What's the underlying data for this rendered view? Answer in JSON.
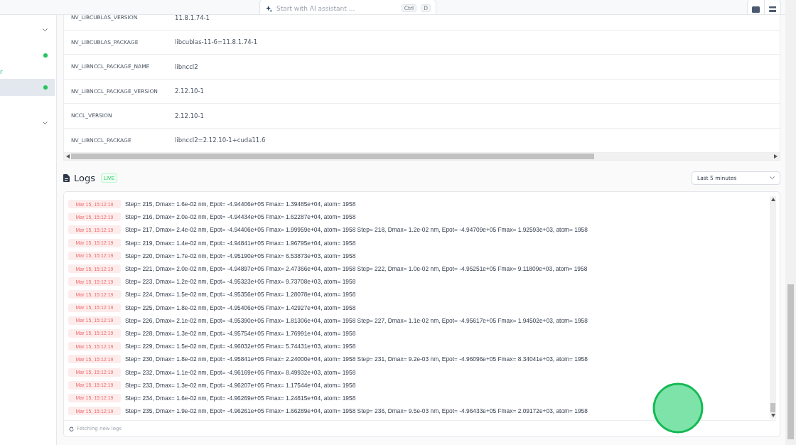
{
  "header": {
    "search": {
      "placeholder": "Start with AI assistant ...",
      "keys": [
        "Ctrl",
        "D"
      ]
    }
  },
  "sidebar": {
    "items": [
      {
        "kind": "group",
        "expanded": false
      },
      {
        "kind": "status",
        "color": "#22c55e",
        "selected": false
      },
      {
        "kind": "text",
        "label": "r"
      },
      {
        "kind": "status",
        "color": "#22c55e",
        "selected": true
      },
      {
        "kind": "group",
        "expanded": false
      }
    ]
  },
  "env_table": {
    "rows": [
      {
        "name": "NV_LIBCUBLAS_VERSION",
        "value": "11.8.1.74-1"
      },
      {
        "name": "NV_LIBCUBLAS_PACKAGE",
        "value": "libcublas-11-6=11.8.1.74-1"
      },
      {
        "name": "NV_LIBNCCL_PACKAGE_NAME",
        "value": "libnccl2"
      },
      {
        "name": "NV_LIBNCCL_PACKAGE_VERSION",
        "value": "2.12.10-1"
      },
      {
        "name": "NCCL_VERSION",
        "value": "2.12.10-1"
      },
      {
        "name": "NV_LIBNCCL_PACKAGE",
        "value": "libnccl2=2.12.10-1+cuda11.6"
      }
    ]
  },
  "logs": {
    "title": "Logs",
    "badge": "LIVE",
    "range": "Last 5 minutes",
    "entries": [
      {
        "time": "Mar 15, 15:12:19",
        "message": "Step= 215, Dmax= 1.6e-02 nm, Epot= -4.94406e+05 Fmax= 1.39485e+04, atom= 1958"
      },
      {
        "time": "Mar 15, 15:12:19",
        "message": "Step= 216, Dmax= 2.0e-02 nm, Epot= -4.94434e+05 Fmax= 1.62287e+04, atom= 1958"
      },
      {
        "time": "Mar 15, 15:12:19",
        "message": "Step= 217, Dmax= 2.4e-02 nm, Epot= -4.94406e+05 Fmax= 1.99959e+04, atom= 1958 Step= 218, Dmax= 1.2e-02 nm, Epot= -4.94709e+05 Fmax= 1.92593e+03, atom= 1958"
      },
      {
        "time": "Mar 15, 15:12:19",
        "message": "Step= 219, Dmax= 1.4e-02 nm, Epot= -4.94841e+05 Fmax= 1.96795e+04, atom= 1958"
      },
      {
        "time": "Mar 15, 15:12:19",
        "message": "Step= 220, Dmax= 1.7e-02 nm, Epot= -4.95190e+05 Fmax= 6.53873e+03, atom= 1958"
      },
      {
        "time": "Mar 15, 15:12:19",
        "message": "Step= 221, Dmax= 2.0e-02 nm, Epot= -4.94897e+05 Fmax= 2.47366e+04, atom= 1958 Step= 222, Dmax= 1.0e-02 nm, Epot= -4.95251e+05 Fmax= 9.11809e+03, atom= 1958"
      },
      {
        "time": "Mar 15, 15:12:19",
        "message": "Step= 223, Dmax= 1.2e-02 nm, Epot= -4.95323e+05 Fmax= 9.73708e+03, atom= 1958"
      },
      {
        "time": "Mar 15, 15:12:19",
        "message": "Step= 224, Dmax= 1.5e-02 nm, Epot= -4.95356e+05 Fmax= 1.28078e+04, atom= 1958"
      },
      {
        "time": "Mar 15, 15:12:19",
        "message": "Step= 225, Dmax= 1.8e-02 nm, Epot= -4.95406e+05 Fmax= 1.42927e+04, atom= 1958"
      },
      {
        "time": "Mar 15, 15:12:19",
        "message": "Step= 226, Dmax= 2.1e-02 nm, Epot= -4.95390e+05 Fmax= 1.81306e+04, atom= 1958 Step= 227, Dmax= 1.1e-02 nm, Epot= -4.95617e+05 Fmax= 1.94502e+03, atom= 1958"
      },
      {
        "time": "Mar 15, 15:12:19",
        "message": "Step= 228, Dmax= 1.3e-02 nm, Epot= -4.95754e+05 Fmax= 1.76991e+04, atom= 1958"
      },
      {
        "time": "Mar 15, 15:12:19",
        "message": "Step= 229, Dmax= 1.5e-02 nm, Epot= -4.96032e+05 Fmax= 5.74431e+03, atom= 1958"
      },
      {
        "time": "Mar 15, 15:12:19",
        "message": "Step= 230, Dmax= 1.8e-02 nm, Epot= -4.95841e+05 Fmax= 2.24000e+04, atom= 1958 Step= 231, Dmax= 9.2e-03 nm, Epot= -4.96096e+05 Fmax= 8.34041e+03, atom= 1958"
      },
      {
        "time": "Mar 15, 15:12:19",
        "message": "Step= 232, Dmax= 1.1e-02 nm, Epot= -4.96169e+05 Fmax= 8.49932e+03, atom= 1958"
      },
      {
        "time": "Mar 15, 15:12:19",
        "message": "Step= 233, Dmax= 1.3e-02 nm, Epot= -4.96207e+05 Fmax= 1.17544e+04, atom= 1958"
      },
      {
        "time": "Mar 15, 15:12:19",
        "message": "Step= 234, Dmax= 1.6e-02 nm, Epot= -4.96269e+05 Fmax= 1.24815e+04, atom= 1958"
      },
      {
        "time": "Mar 15, 15:12:19",
        "message": "Step= 235, Dmax= 1.9e-02 nm, Epot= -4.96261e+05 Fmax= 1.66289e+04, atom= 1958 Step= 236, Dmax= 9.5e-03 nm, Epot= -4.96433e+05 Fmax= 2.09172e+03, atom= 1958"
      }
    ],
    "footer": "Fetching new logs"
  }
}
